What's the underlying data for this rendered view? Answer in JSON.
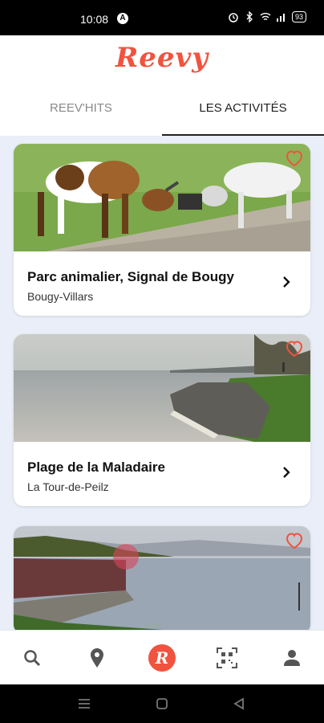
{
  "status_bar": {
    "time": "10:08",
    "battery": "93"
  },
  "app": {
    "logo": "Reevy"
  },
  "tabs": [
    {
      "label": "REEV'HITS",
      "active": false
    },
    {
      "label": "LES ACTIVITÉS",
      "active": true
    }
  ],
  "activities": [
    {
      "title": "Parc animalier, Signal de Bougy",
      "place": "Bougy-Villars",
      "photo": "goats-icon"
    },
    {
      "title": "Plage de la Maladaire",
      "place": "La Tour-de-Peilz",
      "photo": "lake-shore-icon"
    },
    {
      "title": "",
      "place": "",
      "photo": "lake-sunset-icon"
    }
  ],
  "bottom_nav": [
    "search-icon",
    "map-pin-icon",
    "reevy-logo-icon",
    "qr-scan-icon",
    "profile-icon"
  ],
  "colors": {
    "accent": "#f0533f",
    "list_bg": "#e9eef8"
  }
}
